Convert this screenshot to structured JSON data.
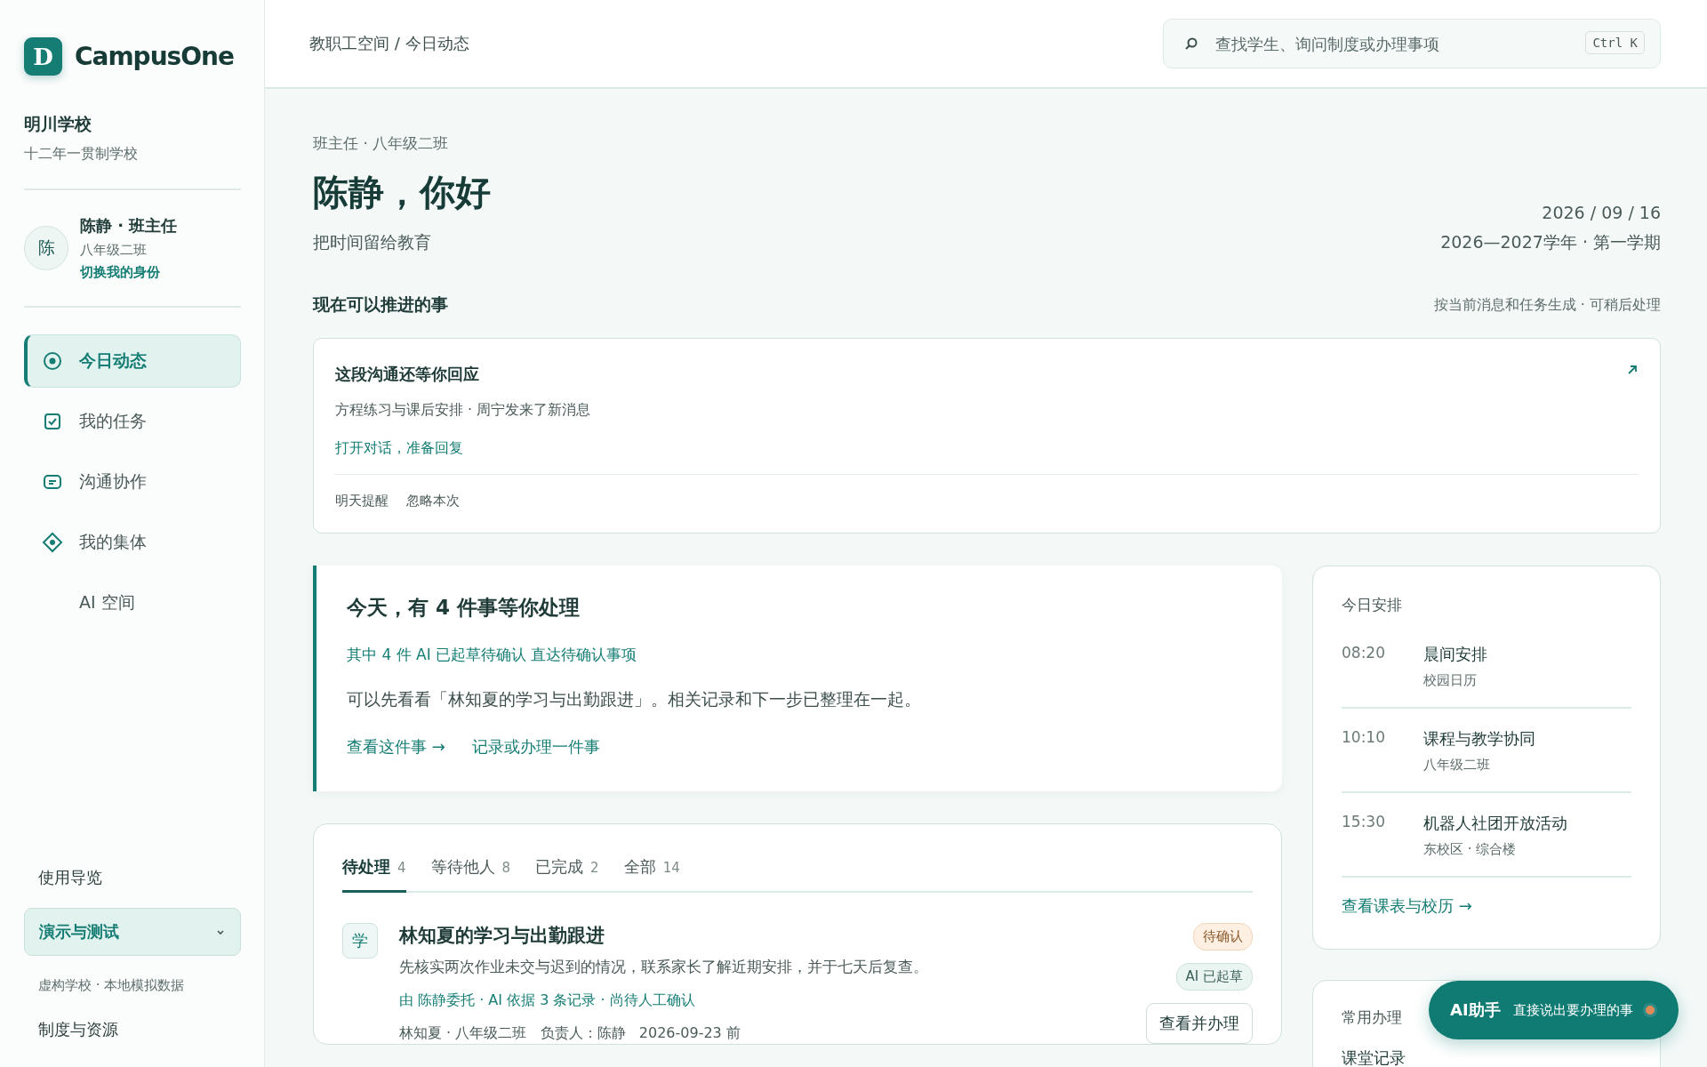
{
  "brand": {
    "logo_letter": "D",
    "name": "CampusOne"
  },
  "school": {
    "name": "明川学校",
    "type": "十二年一贯制学校"
  },
  "user": {
    "avatar": "陈",
    "name": "陈静 · 班主任",
    "class": "八年级二班",
    "switch_link": "切换我的身份"
  },
  "nav": [
    {
      "label": "今日动态",
      "selected": true
    },
    {
      "label": "我的任务",
      "selected": false
    },
    {
      "label": "沟通协作",
      "selected": false
    },
    {
      "label": "我的集体",
      "selected": false
    },
    {
      "label": "AI 空间",
      "selected": false
    }
  ],
  "sidebar_footer": {
    "guide": "使用导览",
    "demo": {
      "label": "演示与测试",
      "expanded": false,
      "note": "虚构学校 · 本地模拟数据"
    },
    "resources": "制度与资源"
  },
  "header": {
    "breadcrumb": "教职工空间 / 今日动态",
    "search": {
      "placeholder": "查找学生、询问制度或办理事项",
      "shortcut": "Ctrl K"
    }
  },
  "hero": {
    "role": "班主任 · 八年级二班",
    "greeting": "陈静，你好",
    "tagline": "把时间留给教育",
    "date": "2026 / 09 / 16",
    "term": "2026—2027学年 · 第一学期"
  },
  "suggestions": {
    "title": "现在可以推进的事",
    "note": "按当前消息和任务生成 · 可稍后处理",
    "card": {
      "title": "这段沟通还等你回应",
      "detail": "方程练习与课后安排 · 周宁发来了新消息",
      "action": "打开对话，准备回复",
      "secondary": [
        "明天提醒",
        "忽略本次"
      ]
    }
  },
  "focus": {
    "title": "今天，有 4 件事等你处理",
    "ai_note": "其中 4 件 AI 已起草待确认 直达待确认事项",
    "body": "可以先看看「林知夏的学习与出勤跟进」。相关记录和下一步已整理在一起。",
    "links": [
      "查看这件事 →",
      "记录或办理一件事"
    ]
  },
  "tasks": {
    "tabs": [
      {
        "label": "待处理",
        "count": "4",
        "selected": true
      },
      {
        "label": "等待他人",
        "count": "8",
        "selected": false
      },
      {
        "label": "已完成",
        "count": "2",
        "selected": false
      },
      {
        "label": "全部",
        "count": "14",
        "selected": false
      }
    ],
    "items": [
      {
        "badge": "学",
        "title": "林知夏的学习与出勤跟进",
        "summary": "先核实两次作业未交与迟到的情况，联系家长了解近期安排，并于七天后复查。",
        "provenance": "由 陈静委托 · AI 依据 3 条记录 · 尚待人工确认",
        "meta": "林知夏 · 八年级二班   负责人：陈静   2026-09-23 前",
        "status": "待确认",
        "ai_tag": "AI 已起草",
        "action": "查看并办理"
      }
    ]
  },
  "schedule": {
    "title": "今日安排",
    "items": [
      {
        "time": "08:20",
        "title": "晨间安排",
        "place": "校园日历"
      },
      {
        "time": "10:10",
        "title": "课程与教学协同",
        "place": "八年级二班"
      },
      {
        "time": "15:30",
        "title": "机器人社团开放活动",
        "place": "东校区 · 综合楼"
      }
    ],
    "link": "查看课表与校历 →"
  },
  "common": {
    "title": "常用办理",
    "items": [
      "课堂记录"
    ]
  },
  "assistant": {
    "label": "AI助手",
    "hint": "直接说出要办理的事",
    "online": true
  }
}
